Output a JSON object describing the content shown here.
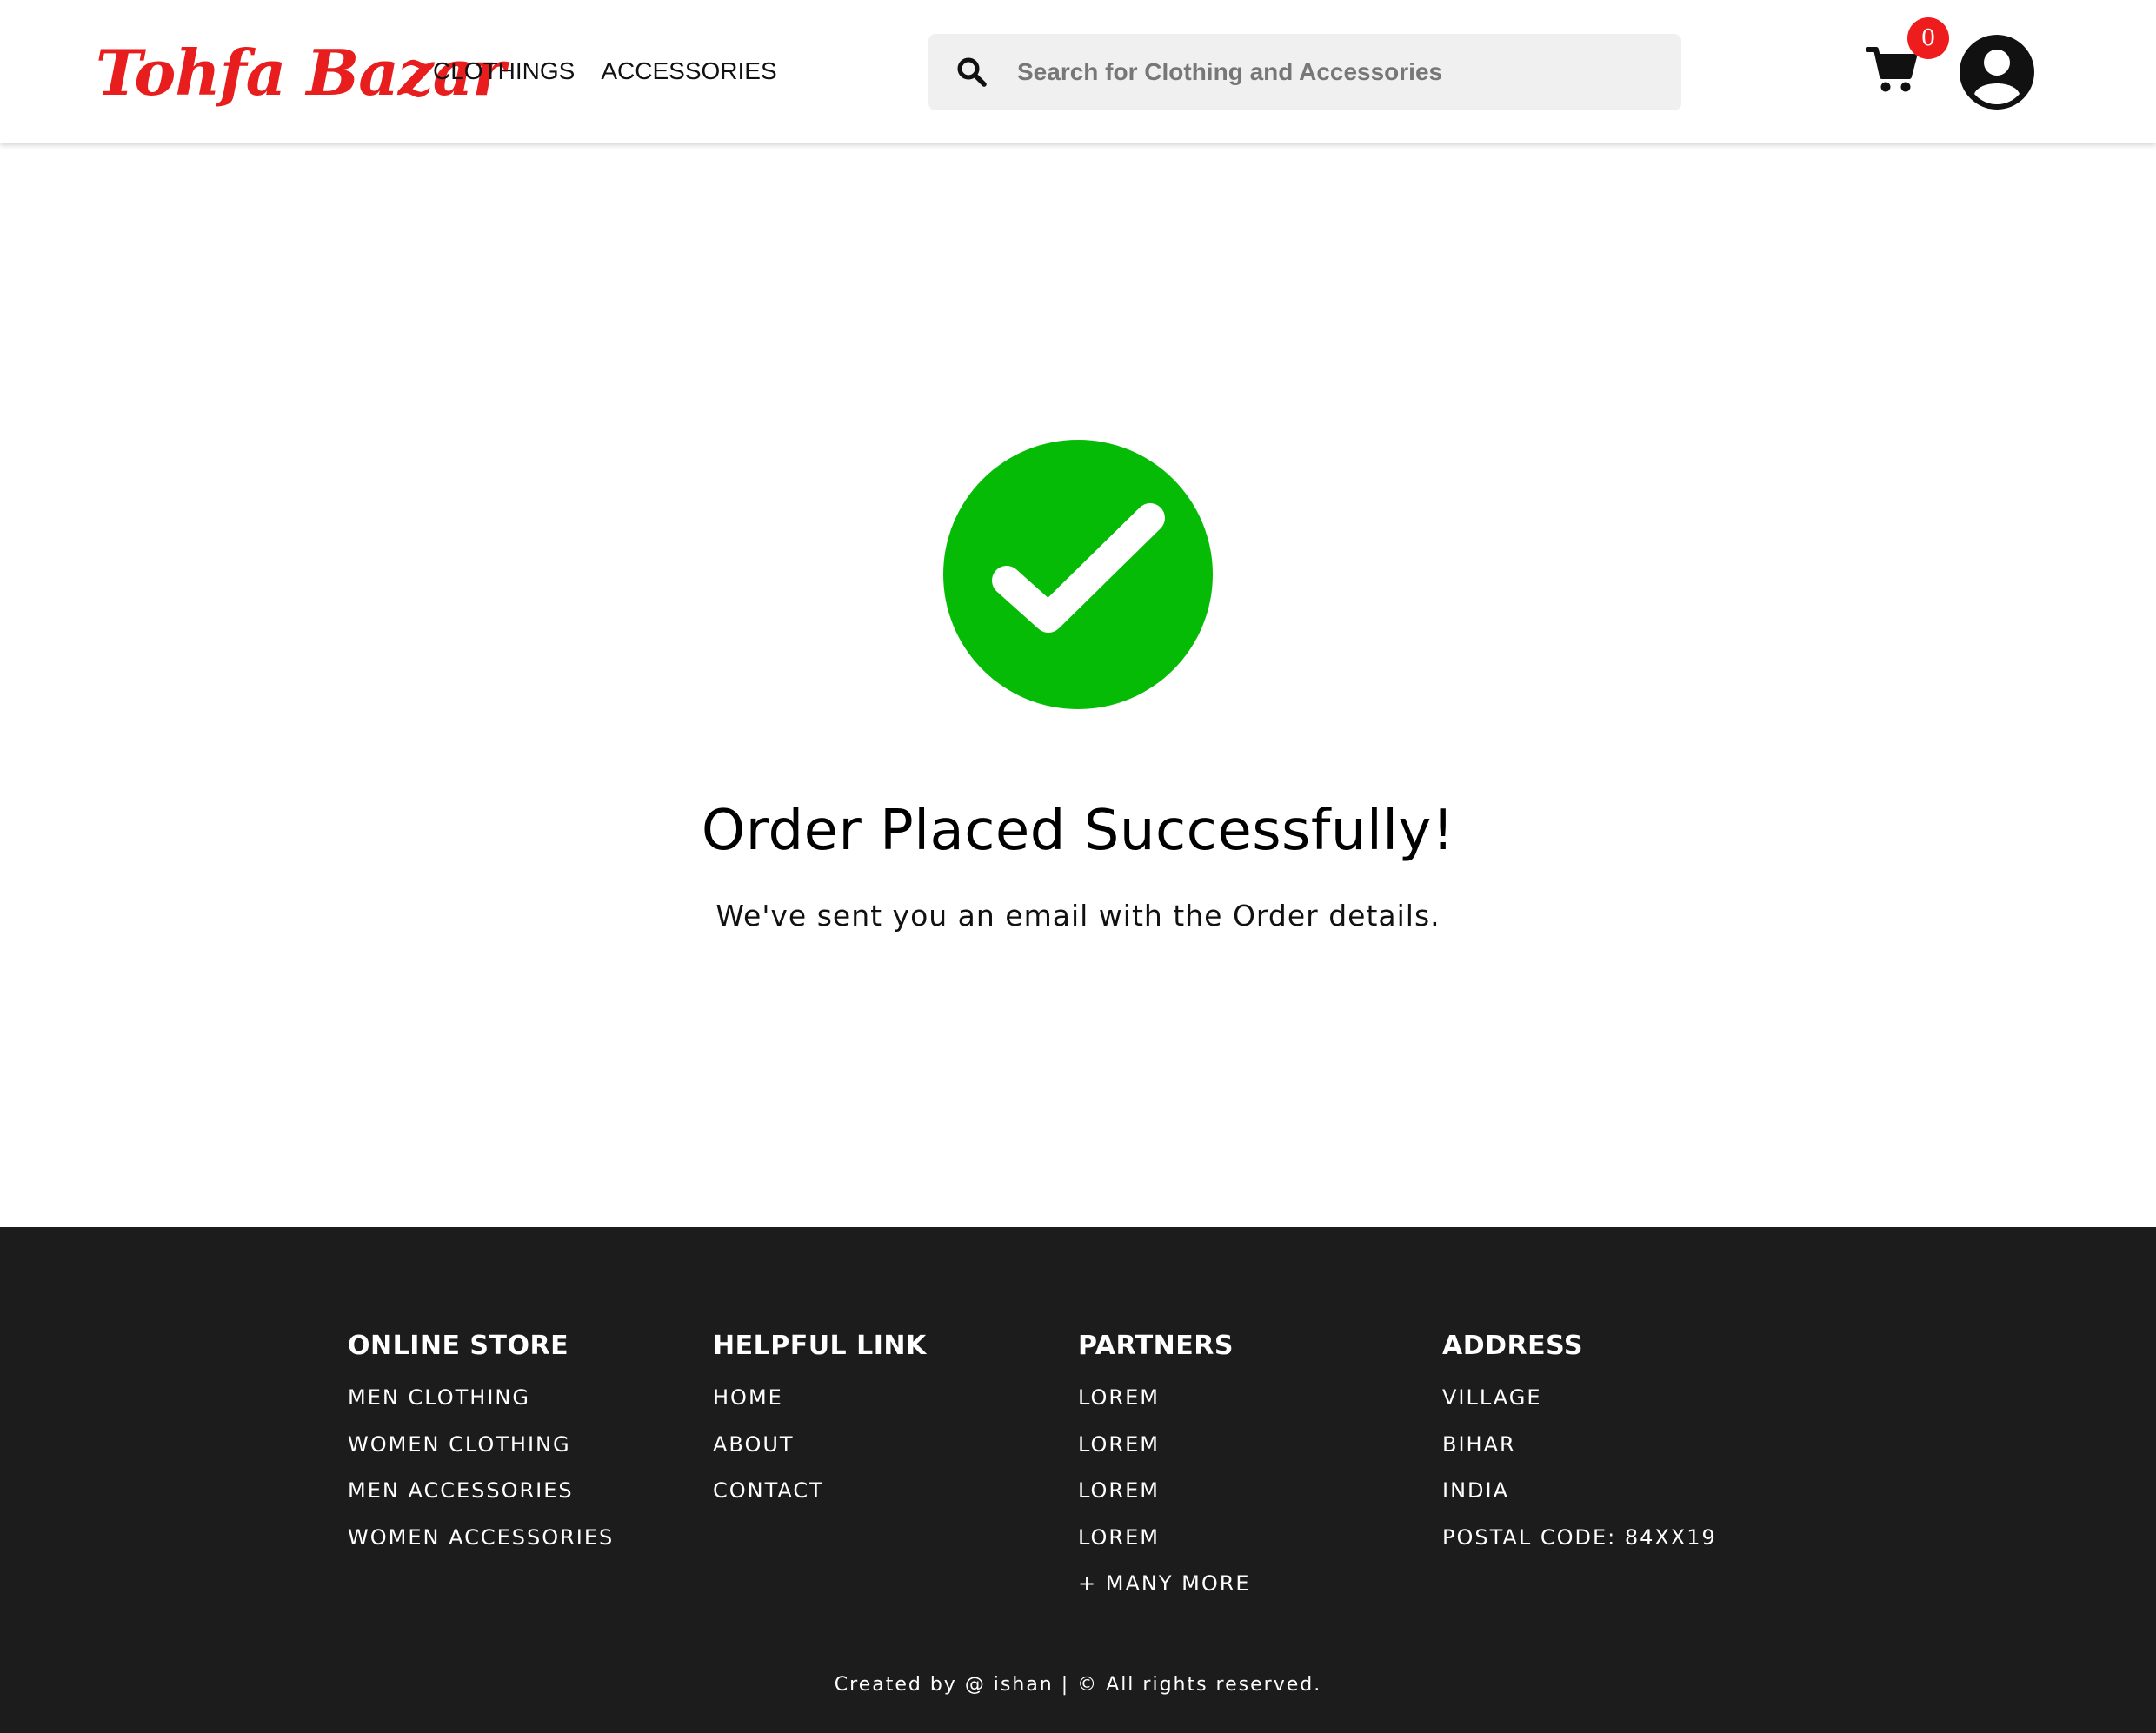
{
  "header": {
    "logo": "Tohfa Bazar",
    "nav": [
      "CLOTHINGS",
      "ACCESSORIES"
    ],
    "search": {
      "placeholder": "Search for Clothing and Accessories",
      "value": ""
    },
    "cart_count": "0",
    "brand_color": "#e81d1d"
  },
  "main": {
    "icon": "check-circle-icon",
    "icon_color": "#06bb06",
    "title": "Order Placed Successfully!",
    "subtitle": "We've sent you an email with the Order details."
  },
  "footer": {
    "columns": [
      {
        "heading": "ONLINE STORE",
        "items": [
          "MEN CLOTHING",
          "WOMEN CLOTHING",
          "MEN ACCESSORIES",
          "WOMEN ACCESSORIES"
        ]
      },
      {
        "heading": "HELPFUL LINK",
        "items": [
          "HOME",
          "ABOUT",
          "CONTACT"
        ]
      },
      {
        "heading": "PARTNERS",
        "items": [
          "LOREM",
          "LOREM",
          "LOREM",
          "LOREM",
          "+ MANY MORE"
        ]
      },
      {
        "heading": "ADDRESS",
        "items": [
          "VILLAGE",
          "BIHAR",
          "INDIA",
          "POSTAL CODE: 84XX19"
        ]
      }
    ],
    "copyright": "Created by @ ishan | © All rights reserved.",
    "background": "#1c1c1c"
  }
}
